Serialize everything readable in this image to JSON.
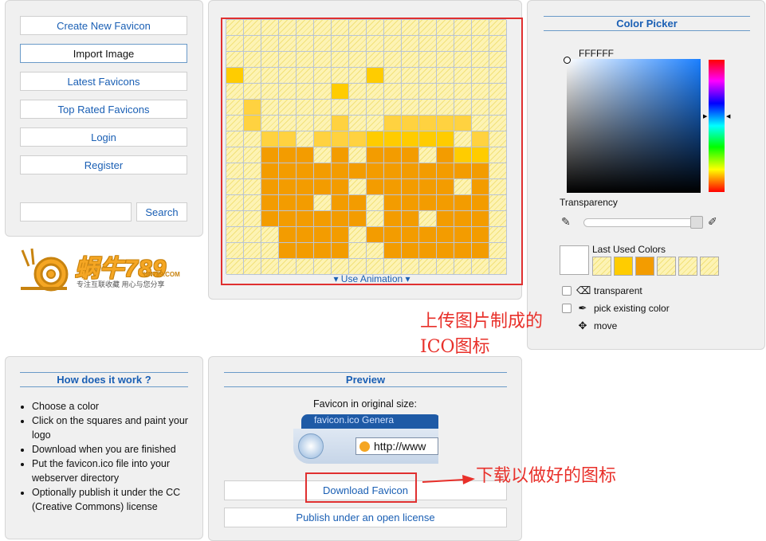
{
  "nav": {
    "create_new": "Create New Favicon",
    "import_image": "Import Image",
    "latest": "Latest Favicons",
    "top_rated": "Top Rated Favicons",
    "login": "Login",
    "register": "Register",
    "search_value": "",
    "search_button": "Search"
  },
  "logo": {
    "text": "蜗牛789",
    "domain": "UN789.COM",
    "sub": "专注互联收藏  用心与您分享"
  },
  "canvas": {
    "rows": 16,
    "cols": 16,
    "pixels": [
      "................",
      "................",
      "................",
      "Y.......Y.......",
      "......Y.........",
      ".L..............",
      ".L....L..LLLLL..",
      "..LL.LLLYYYYY.L.",
      "..OOO.O.OOO.OYY.",
      "..OOOOOOOOOOOOO.",
      "..OOOOO.OOOOO.O.",
      "..OOO.OO.OOOOOO.",
      "..OOOOOO.OO.OOO.",
      "...OOOO.OOOOOOO.",
      "...OOOO..OOOOOO.",
      "................"
    ],
    "palette": {
      "Y": "#ffcc00",
      "L": "#ffd240",
      "O": "#f39c00"
    },
    "animation_link": "▾ Use Animation ▾"
  },
  "picker": {
    "title": "Color Picker",
    "value": "FFFFFF",
    "transparency_label": "Transparency",
    "last_used_label": "Last Used Colors",
    "last_used": [
      "transparent",
      "#ffcc00",
      "#f39c00",
      "transparent",
      "transparent",
      "transparent"
    ],
    "options": {
      "transparent": "transparent",
      "pick_existing": "pick existing color",
      "move": "move"
    }
  },
  "how": {
    "title": "How does it work ?",
    "steps": [
      "Choose a color",
      "Click on the squares and paint your logo",
      "Download when you are finished",
      "Put the favicon.ico file into your webserver directory",
      "Optionally publish it under the CC (Creative Commons) license"
    ]
  },
  "preview": {
    "title": "Preview",
    "original_size_label": "Favicon in original size:",
    "browser_title": "favicon.ico Genera",
    "browser_url": "http://www",
    "download_button": "Download Favicon",
    "publish_button": "Publish under an open license"
  },
  "annotations": {
    "upload_line1": "上传图片制成的",
    "upload_line2": "ICO图标",
    "download_note": "下载以做好的图标",
    "accent_color": "#e8302a"
  }
}
